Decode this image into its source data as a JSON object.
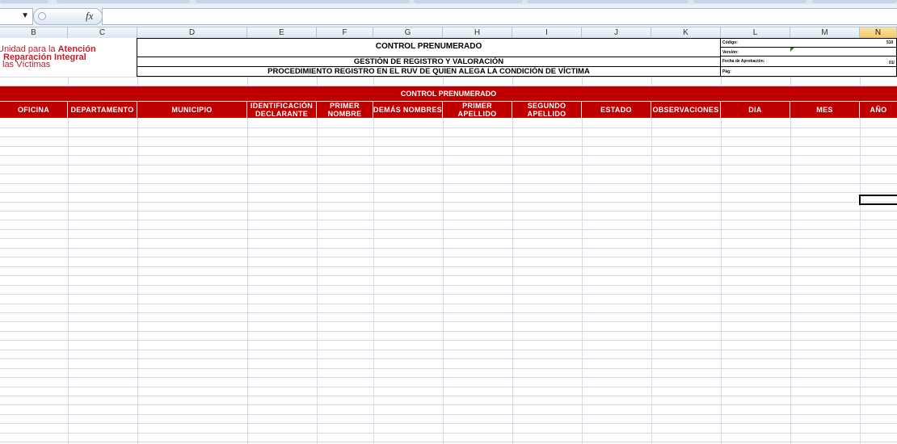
{
  "formula_bar": {
    "fx_label": "fx",
    "value": ""
  },
  "columns": [
    "B",
    "C",
    "D",
    "E",
    "F",
    "G",
    "H",
    "I",
    "J",
    "K",
    "L",
    "M",
    "N"
  ],
  "selected_column": "N",
  "logo": {
    "line1_regular": "Unidad para la ",
    "line1_bold": "Atención",
    "line2": "Reparación Integral",
    "line3": "las Víctimas"
  },
  "form_header": {
    "title": "CONTROL PRENUMERADO",
    "subtitle1": "GESTIÓN DE REGISTRO Y VALORACIÓN",
    "subtitle2": "PROCEDIMIENTO REGISTRO EN EL RUV DE QUIEN ALEGA LA CONDICIÓN DE VÍCTIMA"
  },
  "meta": {
    "codigo_label": "Código:",
    "codigo_value": "510",
    "version_label": "Versión:",
    "fecha_label": "Fecha de Aprobación:",
    "fecha_value": "01/",
    "pag_label": "Pág:"
  },
  "banner": "CONTROL PRENUMERADO",
  "table_headers": [
    "OFICINA",
    "DEPARTAMENTO",
    "MUNICIPIO",
    "IDENTIFICACIÓN DECLARANTE",
    "PRIMER NOMBRE",
    "DEMÁS NOMBRES",
    "PRIMER APELLIDO",
    "SEGUNDO APELLIDO",
    "ESTADO",
    "OBSERVACIONES",
    "DIA",
    "MES",
    "AÑO"
  ]
}
